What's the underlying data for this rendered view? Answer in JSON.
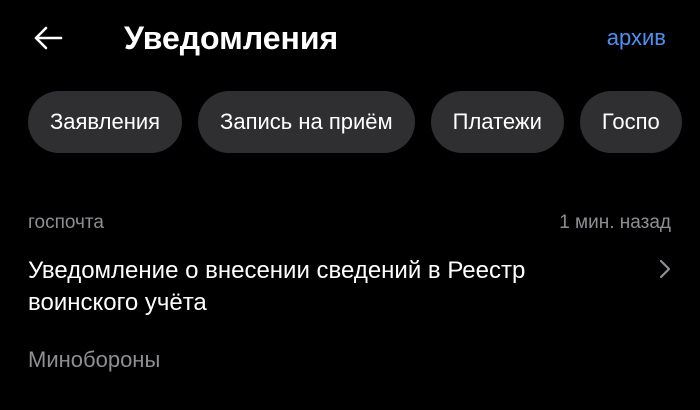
{
  "header": {
    "back_icon": "arrow-left-icon",
    "title": "Уведомления",
    "archive_label": "архив"
  },
  "filters": [
    {
      "label": "Заявления"
    },
    {
      "label": "Запись на приём"
    },
    {
      "label": "Платежи"
    },
    {
      "label": "Госпо"
    }
  ],
  "notification": {
    "source": "госпочта",
    "time": "1 мин. назад",
    "title": "Уведомление о внесении сведений в Реестр воинского учёта",
    "sender": "Минобороны",
    "chevron_icon": "chevron-right-icon"
  },
  "colors": {
    "background": "#000000",
    "chip": "#2f2f31",
    "accent": "#4e8ff2",
    "secondary_text": "#8e8e93"
  }
}
